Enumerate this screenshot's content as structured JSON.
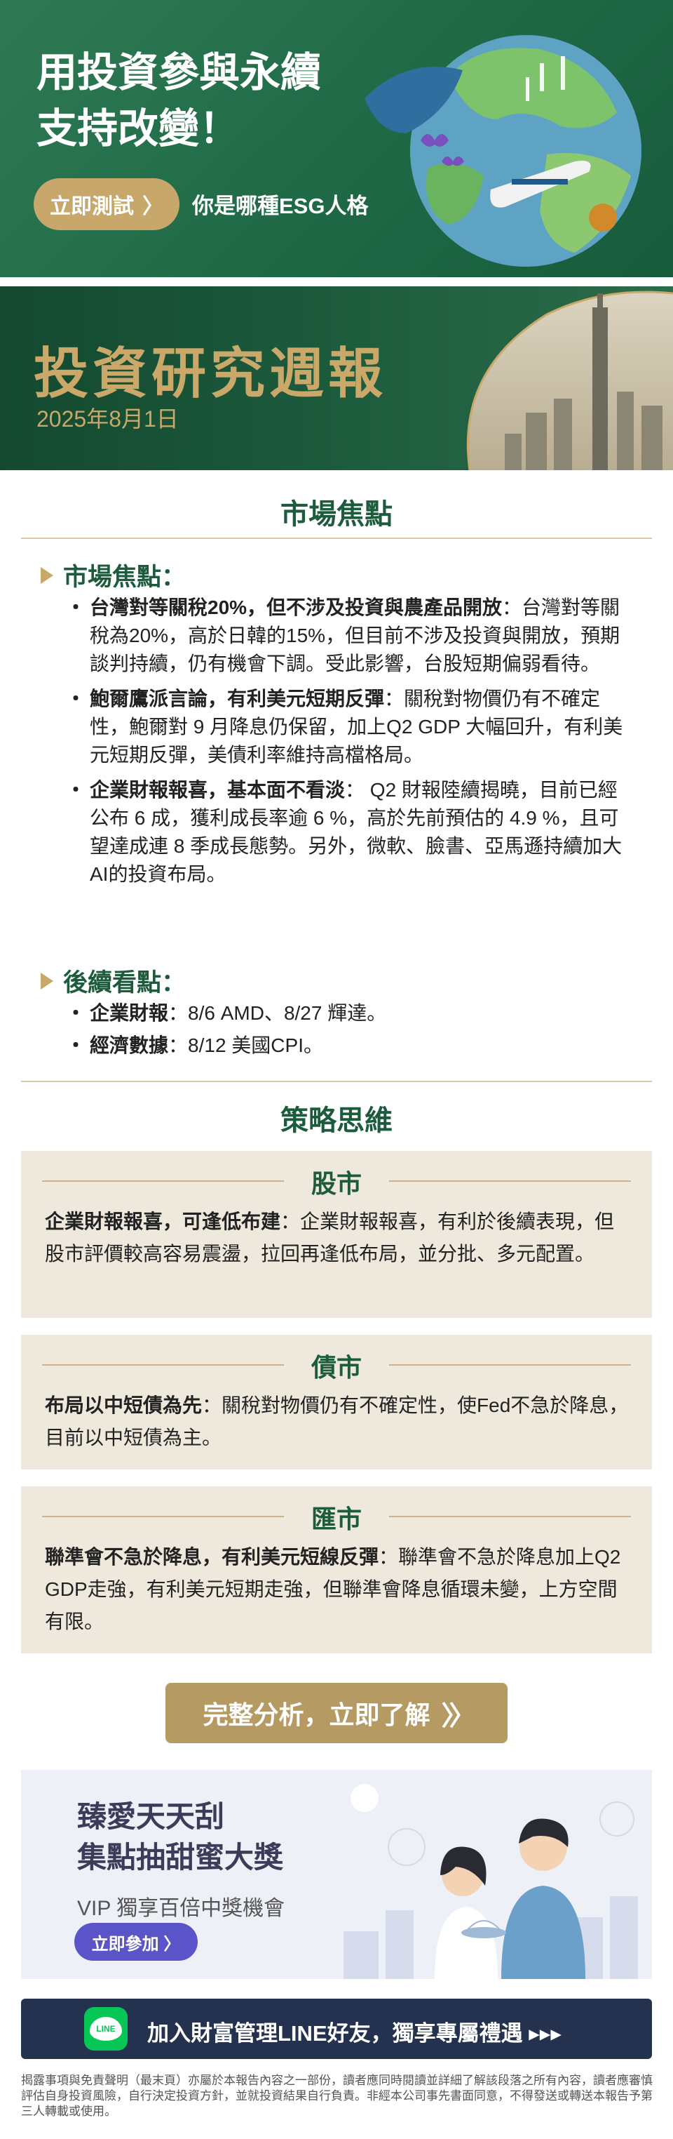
{
  "esg_banner": {
    "title_line1": "用投資參與永續",
    "title_line2": "支持改變！",
    "button_label": "立即測試",
    "subtitle": "你是哪種ESG人格"
  },
  "report_header": {
    "title": "投資研究週報",
    "date": "2025年8月1日"
  },
  "market_focus": {
    "heading": "市場焦點",
    "focus_sub": "市場焦點：",
    "focus_items": [
      {
        "bold": "台灣對等關稅20%，但不涉及投資與農產品開放",
        "text": "：台灣對等關稅為20%，高於日韓的15%，但目前不涉及投資與開放，預期談判持續，仍有機會下調。受此影響，台股短期偏弱看待。"
      },
      {
        "bold": "鮑爾鷹派言論，有利美元短期反彈",
        "text": "：關稅對物價仍有不確定性，鮑爾對 9 月降息仍保留，加上Q2 GDP 大幅回升，有利美元短期反彈，美債利率維持高檔格局。"
      },
      {
        "bold": "企業財報報喜，基本面不看淡",
        "text": "： Q2 財報陸續揭曉，目前已經公布 6 成，獲利成長率逾 6 %，高於先前預估的 4.9 %，且可望達成連 8 季成長態勢。另外，微軟、臉書、亞馬遜持續加大AI的投資布局。"
      }
    ],
    "followup_sub": "後續看點：",
    "followup_items": [
      {
        "bold": "企業財報",
        "text": "：8/6 AMD、8/27 輝達。"
      },
      {
        "bold": "經濟數據",
        "text": "：8/12 美國CPI。"
      }
    ]
  },
  "strategy": {
    "heading": "策略思維",
    "boxes": [
      {
        "title": "股市",
        "bold": "企業財報報喜，可逢低布建",
        "text": "：企業財報報喜，有利於後續表現，但股市評價較高容易震盪，拉回再逢低布局，並分批、多元配置。"
      },
      {
        "title": "債市",
        "bold": "布局以中短債為先",
        "text": "：關稅對物價仍有不確定性，使Fed不急於降息，目前以中短債為主。"
      },
      {
        "title": "匯市",
        "bold": "聯準會不急於降息，有利美元短線反彈",
        "text": "：聯準會不急於降息加上Q2 GDP走強，有利美元短期走強，但聯準會降息循環未變，上方空間有限。"
      }
    ]
  },
  "cta": {
    "label": "完整分析，立即了解"
  },
  "promo": {
    "title_line1": "臻愛天天刮",
    "title_line2": "集點抽甜蜜大獎",
    "subtitle": "VIP 獨享百倍中獎機會",
    "button_label": "立即參加 〉"
  },
  "line_bar": {
    "label": "加入財富管理LINE好友，獨享專屬禮遇 ▸▸▸",
    "icon_text": "LINE"
  },
  "disclaimer": "揭露事項與免責聲明（最末頁）亦屬於本報告內容之一部份，讀者應同時閱讀並詳細了解該段落之所有內容，讀者應審慎評估自身投資風險，自行決定投資方針，並就投資結果自行負責。非經本公司事先書面同意，不得發送或轉送本報告予第三人轉載或使用。",
  "colors": {
    "brand_green": "#1d5b3d",
    "gold": "#c9a86a",
    "beige_box": "#efe9dd",
    "line_green": "#06c755"
  }
}
